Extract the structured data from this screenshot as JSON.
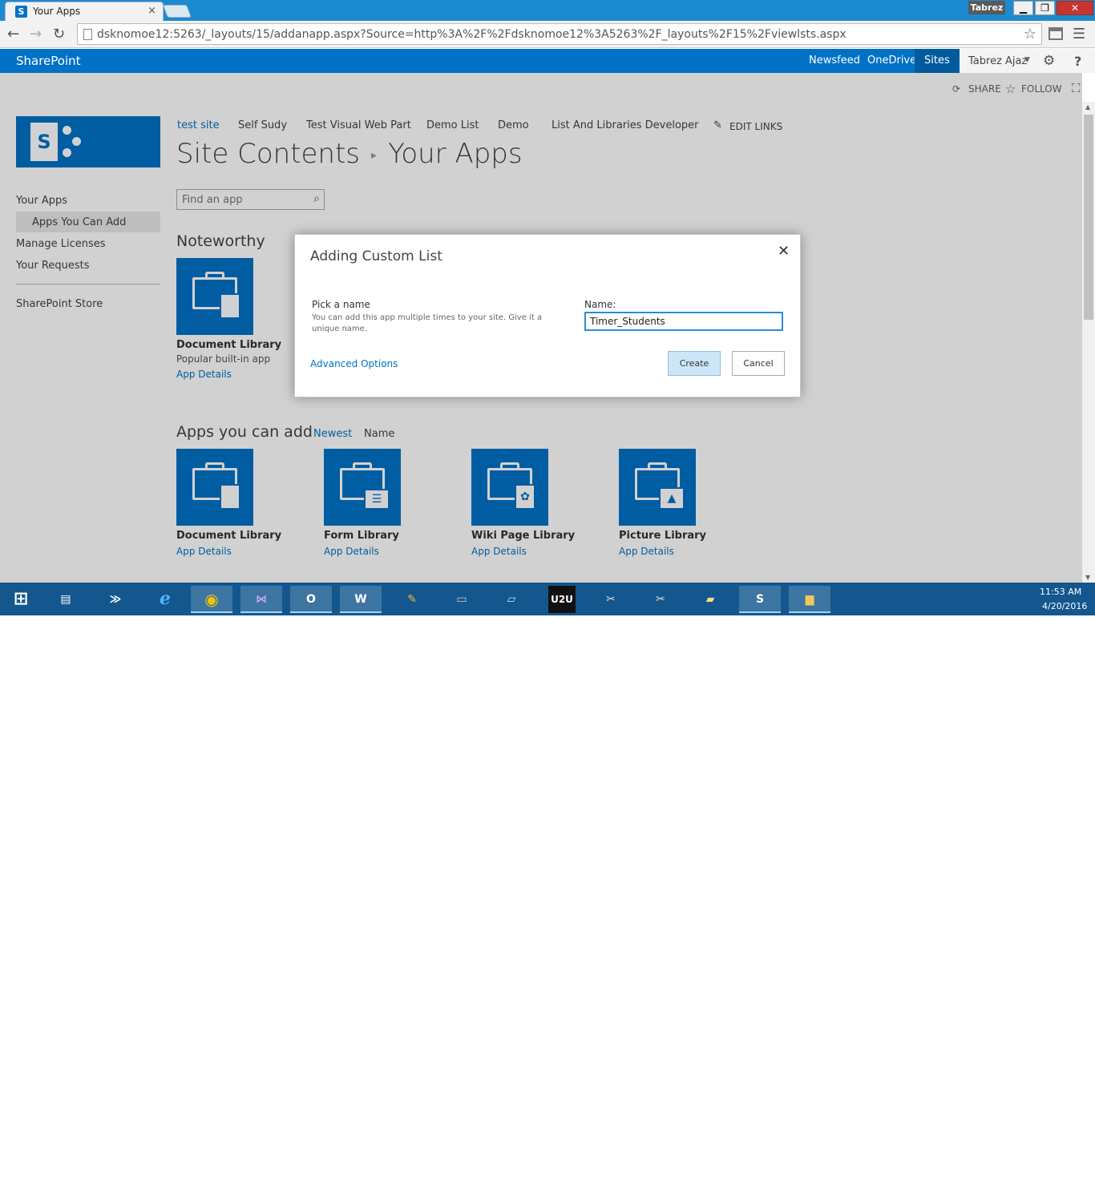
{
  "browser": {
    "tab_title": "Your Apps",
    "tab_close": "×",
    "address": "dsknomoe12:5263/_layouts/15/addanapp.aspx?Source=http%3A%2F%2Fdsknomoe12%3A5263%2F_layouts%2F15%2Fviewlsts.aspx",
    "user_chip": "Tabrez",
    "window_buttons": {
      "minimize": "▁",
      "maximize": "❐",
      "close": "✕"
    }
  },
  "suitebar": {
    "brand": "SharePoint",
    "links": [
      "Newsfeed",
      "OneDrive",
      "Sites"
    ],
    "user": "Tabrez Ajaz",
    "accent": "#0072c6"
  },
  "actions": {
    "share": "SHARE",
    "follow": "FOLLOW"
  },
  "topnav": {
    "items": [
      "test site",
      "Self Sudy",
      "Test Visual Web Part",
      "Demo List",
      "Demo",
      "List And Libraries Developer"
    ],
    "edit_links": "EDIT LINKS"
  },
  "breadcrumb": {
    "parent": "Site Contents",
    "current": "Your Apps"
  },
  "search": {
    "placeholder": "Find an app"
  },
  "quicklaunch": {
    "your_apps": "Your Apps",
    "apps_you_can_add": "Apps You Can Add",
    "manage_licenses": "Manage Licenses",
    "your_requests": "Your Requests",
    "store": "SharePoint Store"
  },
  "noteworthy": {
    "title": "Noteworthy",
    "tile": {
      "name": "Document Library",
      "desc": "Popular built-in app",
      "link": "App Details"
    }
  },
  "apps_section": {
    "title": "Apps you can add",
    "sort_newest": "Newest",
    "sort_name": "Name",
    "tiles": [
      {
        "name": "Document Library",
        "link": "App Details"
      },
      {
        "name": "Form Library",
        "link": "App Details"
      },
      {
        "name": "Wiki Page Library",
        "link": "App Details"
      },
      {
        "name": "Picture Library",
        "link": "App Details"
      }
    ]
  },
  "dialog": {
    "title": "Adding Custom List",
    "pick_label": "Pick a name",
    "pick_desc": "You can add this app multiple times to your site. Give it a unique name.",
    "name_label": "Name:",
    "name_value": "Timer_Students",
    "advanced": "Advanced Options",
    "create": "Create",
    "cancel": "Cancel"
  },
  "taskbar": {
    "time": "11:53 AM",
    "date": "4/20/2016",
    "u2u": "U2U"
  }
}
